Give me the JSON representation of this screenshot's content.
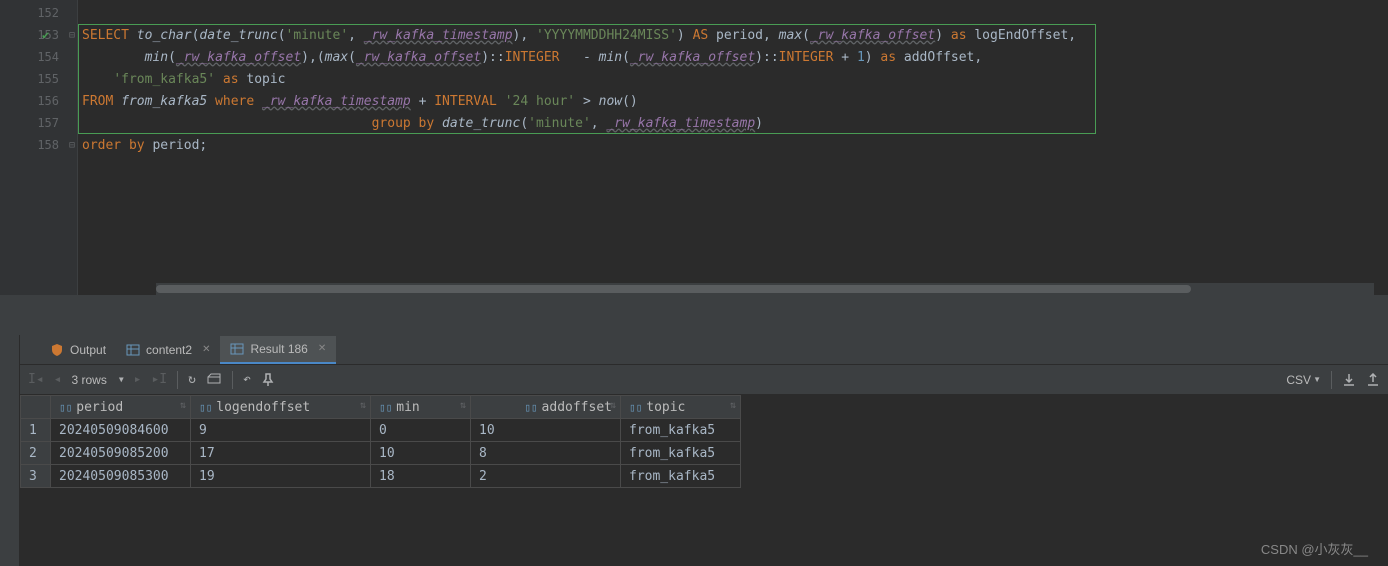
{
  "gutter": {
    "lines": [
      "152",
      "153",
      "154",
      "155",
      "156",
      "157",
      "158"
    ]
  },
  "code": {
    "l153": {
      "select": "SELECT ",
      "to_char": "to_char",
      "p1": "(",
      "date_trunc": "date_trunc",
      "p2": "(",
      "str_minute": "'minute'",
      "c1": ", ",
      "col_ts": "_rw_kafka_timestamp",
      "p3": "), ",
      "str_fmt": "'YYYYMMDDHH24MISS'",
      "p4": ") ",
      "as1": "AS",
      "sp1": " period, ",
      "max": "max",
      "p5": "(",
      "col_off": "_rw_kafka_offset",
      "p6": ") ",
      "as2": "as",
      "sp2": " logEndOffset,"
    },
    "l154": {
      "indent": "        ",
      "min": "min",
      "p1": "(",
      "col_off1": "_rw_kafka_offset",
      "p2": "),(",
      "max": "max",
      "p3": "(",
      "col_off2": "_rw_kafka_offset",
      "p4": ")::",
      "type1": "INTEGER",
      "sp1": "   - ",
      "min2": "min",
      "p5": "(",
      "col_off3": "_rw_kafka_offset",
      "p6": ")::",
      "type2": "INTEGER",
      "sp2": " + ",
      "one": "1",
      "p7": ") ",
      "as": "as",
      "sp3": " addOffset,"
    },
    "l155": {
      "indent": "    ",
      "str": "'from_kafka5'",
      "sp": " ",
      "as": "as",
      "sp2": " topic"
    },
    "l156": {
      "from": "FROM ",
      "tbl": "from_kafka5",
      "where": " where ",
      "col_ts": "_rw_kafka_timestamp",
      "sp1": " + ",
      "interval": "INTERVAL ",
      "str": "'24 hour'",
      "sp2": " > ",
      "now": "now",
      "p": "()"
    },
    "l157": {
      "indent": "                                     ",
      "group": "group by ",
      "date_trunc": "date_trunc",
      "p1": "(",
      "str": "'minute'",
      "c": ", ",
      "col_ts": "_rw_kafka_timestamp",
      "p2": ")"
    },
    "l158": {
      "order": "order by",
      "sp": " period;"
    }
  },
  "tabs": {
    "output": "Output",
    "content2": "content2",
    "result": "Result 186"
  },
  "toolbar": {
    "rows": "3 rows",
    "csv": "CSV"
  },
  "table": {
    "headers": [
      "period",
      "logendoffset",
      "min",
      "addoffset",
      "topic"
    ],
    "rows": [
      {
        "n": "1",
        "period": "20240509084600",
        "logendoffset": "9",
        "min": "0",
        "addoffset": "10",
        "topic": "from_kafka5"
      },
      {
        "n": "2",
        "period": "20240509085200",
        "logendoffset": "17",
        "min": "10",
        "addoffset": "8",
        "topic": "from_kafka5"
      },
      {
        "n": "3",
        "period": "20240509085300",
        "logendoffset": "19",
        "min": "18",
        "addoffset": "2",
        "topic": "from_kafka5"
      }
    ]
  },
  "watermark": "CSDN @小灰灰__"
}
